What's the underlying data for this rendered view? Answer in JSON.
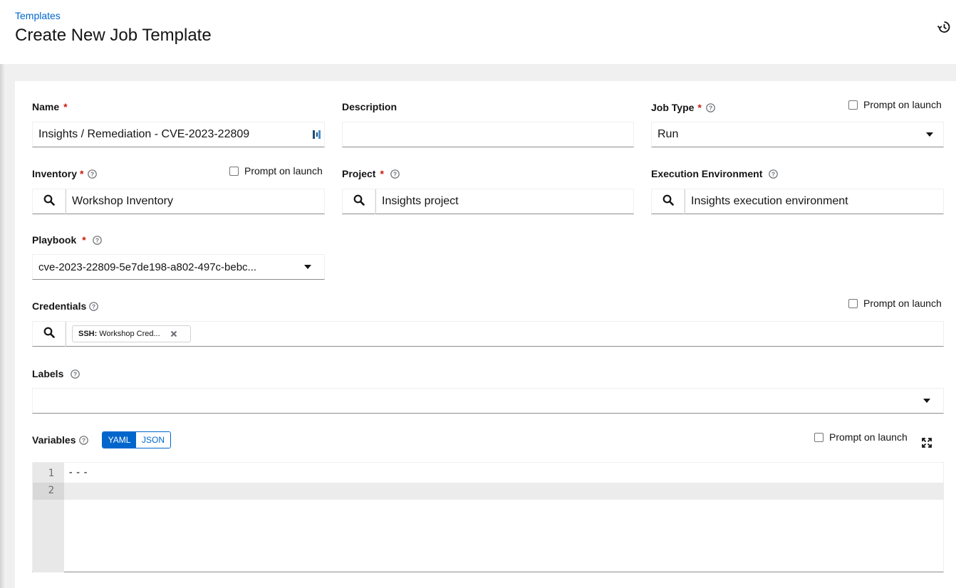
{
  "breadcrumb": {
    "label": "Templates"
  },
  "page": {
    "title": "Create New Job Template"
  },
  "form": {
    "name": {
      "label": "Name",
      "required": "*",
      "value": "Insights / Remediation - CVE-2023-22809"
    },
    "description": {
      "label": "Description",
      "value": ""
    },
    "job_type": {
      "label": "Job Type",
      "required": "*",
      "value": "Run",
      "prompt_label": "Prompt on launch"
    },
    "inventory": {
      "label": "Inventory",
      "required": "*",
      "value": "Workshop Inventory",
      "prompt_label": "Prompt on launch"
    },
    "project": {
      "label": "Project",
      "required": "*",
      "value": "Insights project"
    },
    "execution_environment": {
      "label": "Execution Environment",
      "value": "Insights execution environment"
    },
    "playbook": {
      "label": "Playbook",
      "required": "*",
      "value": "cve-2023-22809-5e7de198-a802-497c-bebc..."
    },
    "credentials": {
      "label": "Credentials",
      "prompt_label": "Prompt on launch",
      "chip_type": "SSH:",
      "chip_value": "Workshop Cred..."
    },
    "labels": {
      "label": "Labels"
    },
    "variables": {
      "label": "Variables",
      "toggle_yaml": "YAML",
      "toggle_json": "JSON",
      "prompt_label": "Prompt on launch",
      "line_numbers": [
        "1",
        "2"
      ],
      "code_line_1": "---"
    }
  },
  "colors": {
    "accent": "#0066cc",
    "required": "#c9190b"
  },
  "icons": [
    "history-icon",
    "search-icon",
    "help-icon",
    "caret-down-icon",
    "close-icon",
    "expand-icon",
    "password-manager-icon"
  ]
}
